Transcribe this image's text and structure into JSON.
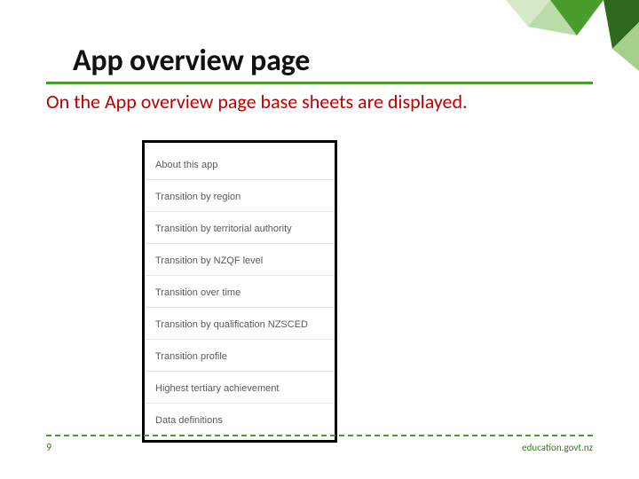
{
  "decor": {
    "triangles": [
      {
        "color": "#d7e8c9"
      },
      {
        "color": "#4a9c2d"
      },
      {
        "color": "#2f6a1c"
      },
      {
        "color": "#a5d08a"
      }
    ]
  },
  "title": "App overview page",
  "subtitle": "On the App overview page base sheets are displayed.",
  "sheets": [
    {
      "label": "About this app"
    },
    {
      "label": "Transition by region"
    },
    {
      "label": "Transition by territorial authority"
    },
    {
      "label": "Transition by NZQF level"
    },
    {
      "label": "Transition over time"
    },
    {
      "label": "Transition by qualification NZSCED"
    },
    {
      "label": "Transition profile"
    },
    {
      "label": "Highest tertiary achievement"
    },
    {
      "label": "Data definitions"
    }
  ],
  "footer": {
    "page_number": "9",
    "link": "education.govt.nz"
  }
}
